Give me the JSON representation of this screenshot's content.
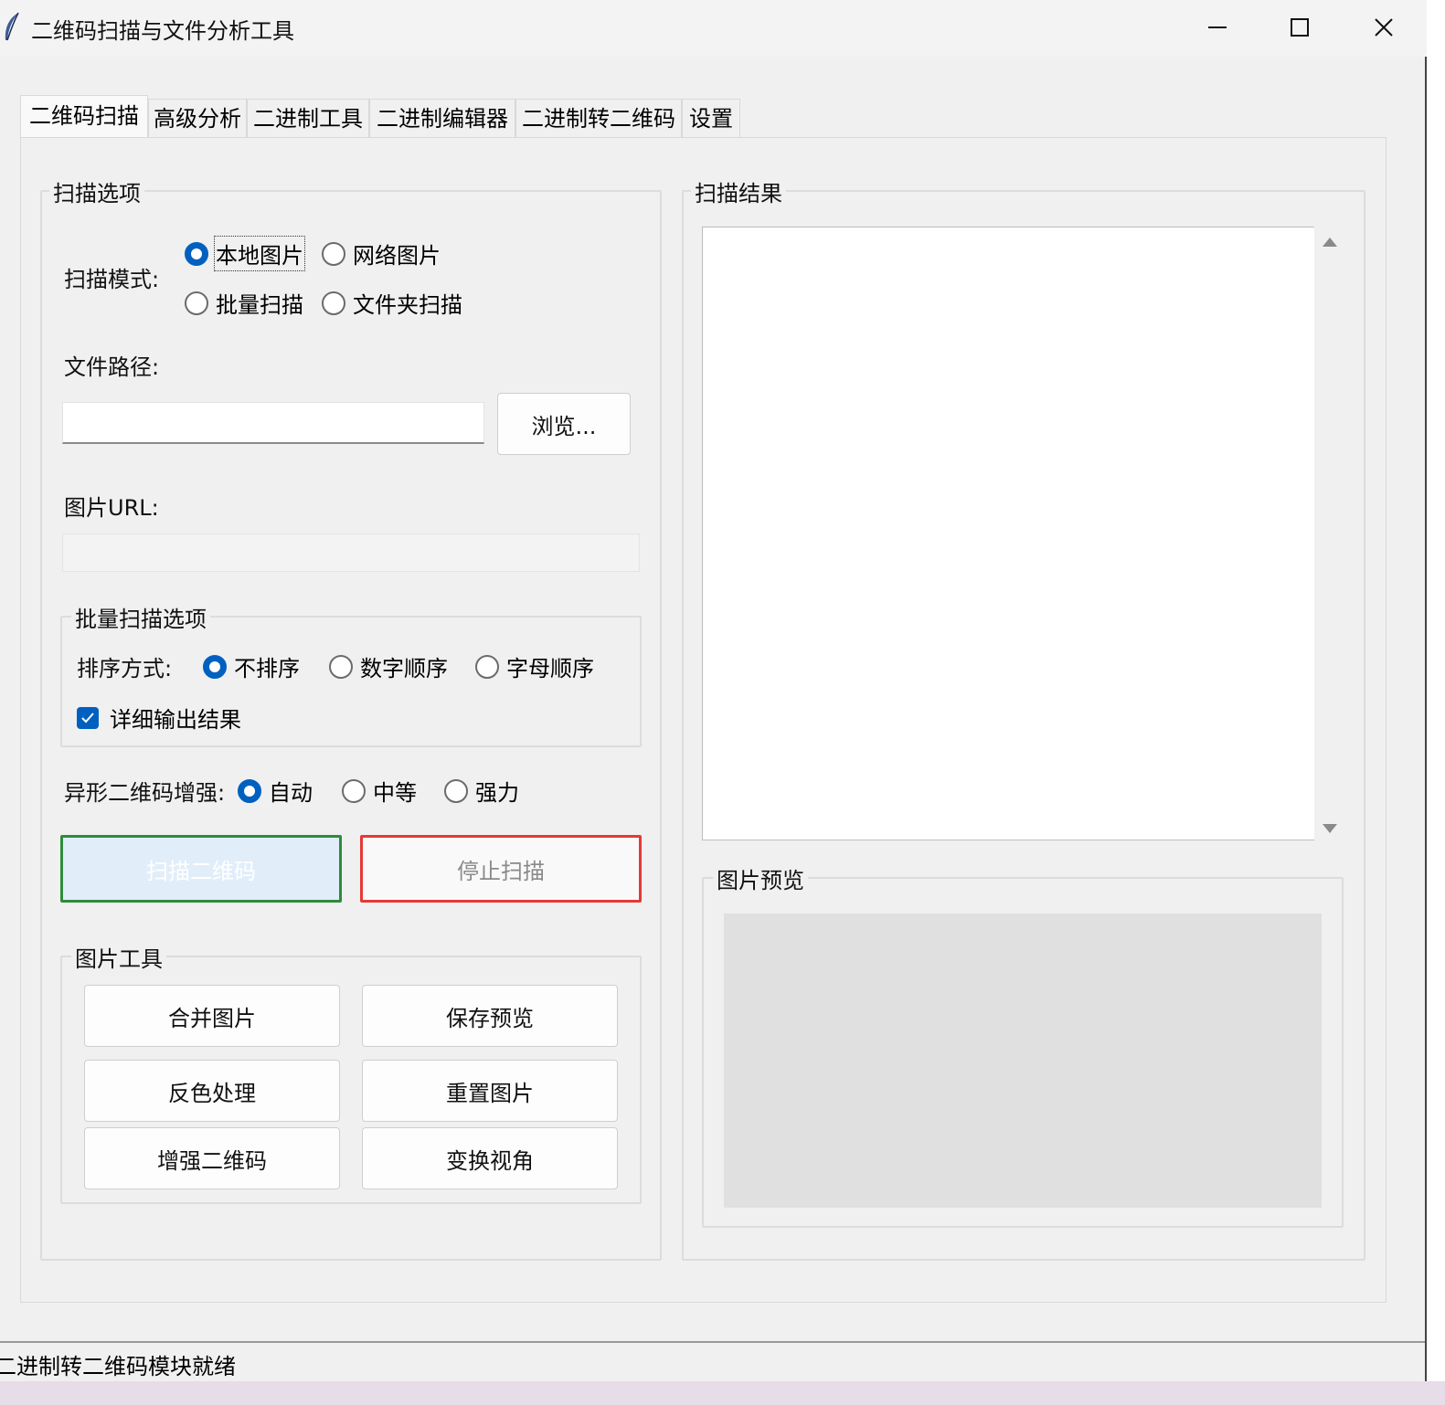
{
  "window": {
    "title": "二维码扫描与文件分析工具"
  },
  "tabs": [
    {
      "label": "二维码扫描",
      "active": true
    },
    {
      "label": "高级分析",
      "active": false
    },
    {
      "label": "二进制工具",
      "active": false
    },
    {
      "label": "二进制编辑器",
      "active": false
    },
    {
      "label": "二进制转二维码",
      "active": false
    },
    {
      "label": "设置",
      "active": false
    }
  ],
  "scan_options": {
    "title": "扫描选项",
    "mode_label": "扫描模式:",
    "modes": [
      "本地图片",
      "网络图片",
      "批量扫描",
      "文件夹扫描"
    ],
    "selected_mode": "本地图片",
    "file_path_label": "文件路径:",
    "file_path_value": "",
    "browse_label": "浏览...",
    "url_label": "图片URL:",
    "url_value": "",
    "batch": {
      "title": "批量扫描选项",
      "sort_label": "排序方式:",
      "sort_options": [
        "不排序",
        "数字顺序",
        "字母顺序"
      ],
      "selected_sort": "不排序",
      "verbose_label": "详细输出结果",
      "verbose_checked": true
    },
    "enhance_label": "异形二维码增强:",
    "enhance_options": [
      "自动",
      "中等",
      "强力"
    ],
    "selected_enhance": "自动",
    "scan_button": "扫描二维码",
    "stop_button": "停止扫描",
    "tools": {
      "title": "图片工具",
      "buttons": [
        "合并图片",
        "保存预览",
        "反色处理",
        "重置图片",
        "增强二维码",
        "变换视角"
      ]
    }
  },
  "results": {
    "title": "扫描结果",
    "text": "",
    "preview_title": "图片预览"
  },
  "status": {
    "text": "二进制转二维码模块就绪"
  },
  "colors": {
    "accent": "#0060c0",
    "scan_border": "#2e8b3a",
    "stop_border": "#e53935"
  }
}
